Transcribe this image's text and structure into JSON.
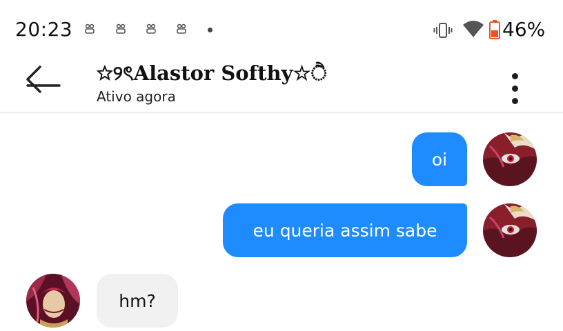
{
  "status_bar": {
    "time": "20:23",
    "battery_percent": "46%",
    "battery_level": 0.46,
    "icons": [
      "notification-icon",
      "notification-icon",
      "notification-icon",
      "notification-icon",
      "more-notifications-dot",
      "vibrate-icon",
      "wifi-icon",
      "battery-icon"
    ]
  },
  "header": {
    "title": "☆୨ৎAlastor Softhy☆ੈ",
    "subtitle": "Ativo agora",
    "back_icon": "arrow-left-icon",
    "menu_icon": "more-vertical-icon"
  },
  "messages": [
    {
      "direction": "outgoing",
      "text": "oi"
    },
    {
      "direction": "outgoing",
      "text": "eu queria assim sabe"
    },
    {
      "direction": "incoming",
      "text": "hm?"
    }
  ],
  "colors": {
    "outgoing_bubble": "#1e8cff",
    "incoming_bubble": "#f1f1f1",
    "battery_low": "#e8541e"
  }
}
